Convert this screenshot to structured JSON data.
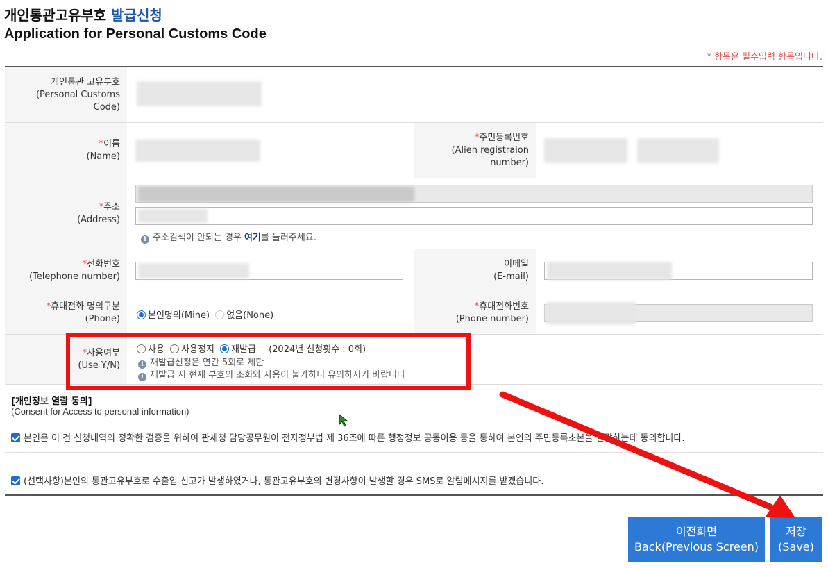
{
  "header": {
    "title_ko_main": "개인통관고유부호",
    "title_ko_accent": "발급신청",
    "title_en": "Application for Personal Customs Code",
    "required_note": "* 항목은 필수입력 항목입니다."
  },
  "form": {
    "customs_code": {
      "label_ko": "개인통관 고유부호",
      "label_en": "(Personal Customs Code)"
    },
    "name": {
      "label_ko": "이름",
      "label_en": "(Name)"
    },
    "alien_reg": {
      "label_ko": "주민등록번호",
      "label_en": "(Alien registraion number)"
    },
    "address": {
      "label_ko": "주소",
      "label_en": "(Address)",
      "hint_pre": "주소검색이 안되는 경우 ",
      "hint_link": "여기",
      "hint_post": "를 눌러주세요."
    },
    "telephone": {
      "label_ko": "전화번호",
      "label_en": "(Telephone number)"
    },
    "email": {
      "label_ko": "이메일",
      "label_en": "(E-mail)"
    },
    "phone_owner": {
      "label_ko": "휴대전화 명의구분",
      "label_en": "(Phone)",
      "options": [
        "본인명의(Mine)",
        "없음(None)"
      ]
    },
    "mobile": {
      "label_ko": "휴대전화번호",
      "label_en": "(Phone number)"
    },
    "use_yn": {
      "label_ko": "사용여부",
      "label_en": "(Use Y/N)",
      "options": [
        "사용",
        "사용정지",
        "재발급"
      ],
      "count_note": "(2024년 신청횟수 : 0회)",
      "hint1": "재발급신청은 연간 5회로 제한",
      "hint2": "재발급 시 현재 부호의 조회와 사용이 불가하니 유의하시기 바랍니다"
    }
  },
  "consent": {
    "title": "[개인정보 열람 동의]",
    "subtitle": "(Consent for Access to personal information)",
    "item1": "본인은 이 건 신청내역의 정확한 검증을 위하여 관세청 담당공무원이 전자정부법 제 36조에 따른 행정정보 공동이용 등을 통하여 본인의 주민등록초본을 열람하는데 동의합니다.",
    "item2": "(선택사항)본인의 통관고유부호로 수출입 신고가 발생하였거나, 통관고유부호의 변경사항이 발생할 경우 SMS로 알림메시지를 받겠습니다."
  },
  "buttons": {
    "back_ko": "이전화면",
    "back_en": "Back(Previous Screen)",
    "save_ko": "저장",
    "save_en": "(Save)"
  },
  "colors": {
    "accent": "#1a5aa8",
    "button": "#2d7ad6",
    "required": "#e05050",
    "highlight": "#ee1111"
  }
}
